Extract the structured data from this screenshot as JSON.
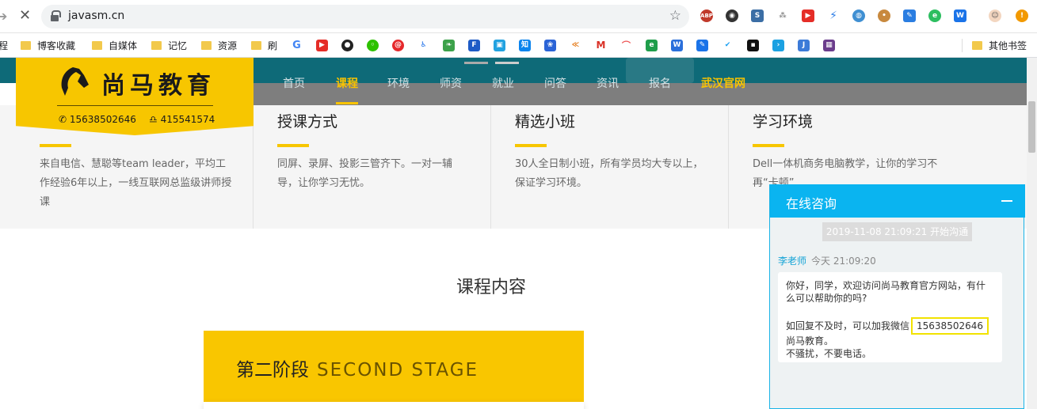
{
  "browser": {
    "url": "javasm.cn",
    "bookmarks": [
      {
        "label": "程"
      },
      {
        "label": "博客收藏"
      },
      {
        "label": "自媒体"
      },
      {
        "label": "记忆"
      },
      {
        "label": "资源"
      },
      {
        "label": "刷"
      }
    ],
    "other_bookmarks": "其他书签",
    "extensions": [
      "ABP",
      "app-icon",
      "S",
      "tree-icon",
      "youtube-icon",
      "bolt-icon",
      "globe-icon",
      "cookie-icon",
      "edit-icon",
      "evernote-icon",
      "W"
    ]
  },
  "site": {
    "logo_text": "尚马教育",
    "phone": "15638502646",
    "qq": "415541574",
    "nav": [
      {
        "label": "首页",
        "active": false
      },
      {
        "label": "课程",
        "active": true
      },
      {
        "label": "环境",
        "active": false
      },
      {
        "label": "师资",
        "active": false
      },
      {
        "label": "就业",
        "active": false
      },
      {
        "label": "问答",
        "active": false
      },
      {
        "label": "资讯",
        "active": false
      },
      {
        "label": "报名",
        "active": false
      },
      {
        "label": "武汉官网",
        "active": true
      }
    ],
    "features": [
      {
        "title": "",
        "desc": "来自电信、慧聪等team leader，平均工作经验6年以上，一线互联网总监级讲师授课"
      },
      {
        "title": "授课方式",
        "desc": "同屏、录屏、投影三管齐下。一对一辅导，让你学习无忧。"
      },
      {
        "title": "精选小班",
        "desc": "30人全日制小班，所有学员均大专以上，保证学习环境。"
      },
      {
        "title": "学习环境",
        "desc": "Dell一体机商务电脑教学，让你的学习不再“卡顿”"
      }
    ],
    "section_title": "课程内容",
    "stage_cn": "第二阶段",
    "stage_en": "SECOND STAGE"
  },
  "chat": {
    "title": "在线咨询",
    "start_time": "2019-11-08 21:09:21 开始沟通",
    "sender": "李老师",
    "sender_time": "今天 21:09:20",
    "msg_line1": "你好，同学，欢迎访问尚马教育官方网站，有什么可以帮助你的吗?",
    "msg_line2_pre": "如回复不及时，可以加我微信",
    "msg_wechat": "15638502646",
    "msg_line2_post": "尚马教育。",
    "msg_line3": "不骚扰，不要电话。"
  },
  "colors": {
    "brand_yellow": "#f7c600",
    "nav_teal": "#0e6a78",
    "chat_blue": "#0ab4f0"
  }
}
